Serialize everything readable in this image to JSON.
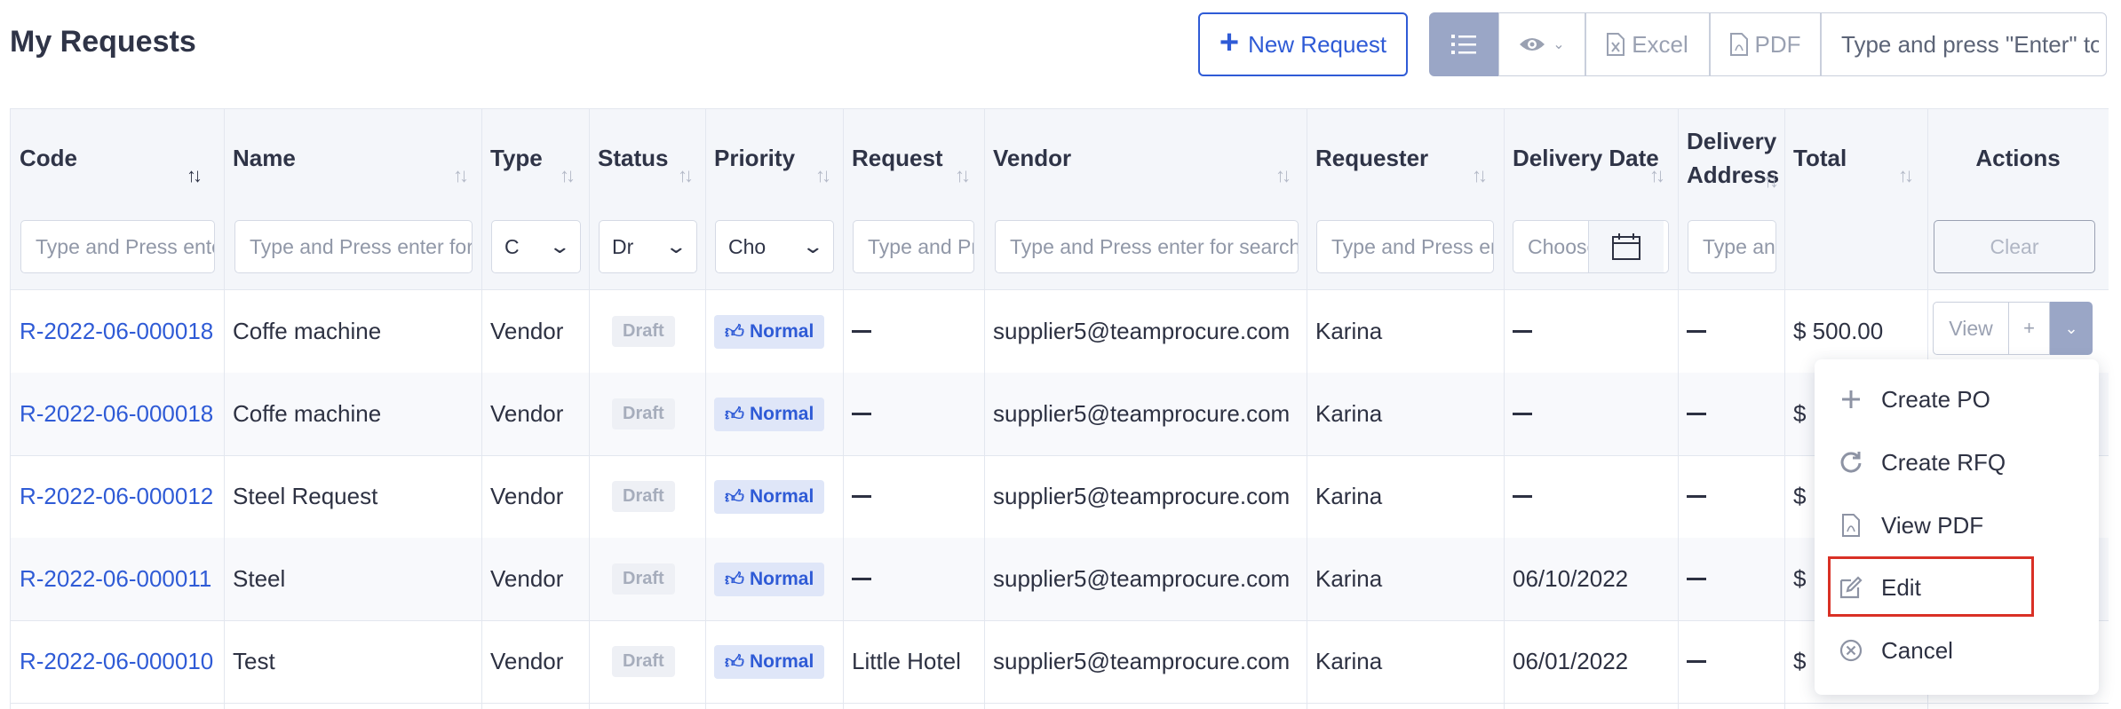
{
  "page": {
    "title": "My Requests"
  },
  "toolbar": {
    "new_request_label": "New Request",
    "excel_label": "Excel",
    "pdf_label": "PDF",
    "search_placeholder": "Type and press \"Enter\" to search"
  },
  "table": {
    "headers": {
      "code": "Code",
      "name": "Name",
      "type": "Type",
      "status": "Status",
      "priority": "Priority",
      "request": "Request",
      "vendor": "Vendor",
      "requester": "Requester",
      "delivery_date": "Delivery Date",
      "delivery_address_1": "Delivery",
      "delivery_address_2": "Address",
      "total": "Total",
      "actions": "Actions"
    },
    "filters": {
      "code": "Type and Press enter",
      "name": "Type and Press enter for search",
      "type": "C",
      "status": "Dr",
      "priority": "Cho",
      "request": "Type and Press",
      "vendor": "Type and Press enter for search",
      "requester": "Type and Press enter",
      "delivery_date": "Choose",
      "delivery_address": "Type and",
      "clear_label": "Clear"
    },
    "rows": [
      {
        "code": "R-2022-06-000018",
        "name": "Coffe machine",
        "type": "Vendor",
        "status": "Draft",
        "priority": "Normal",
        "request": "",
        "vendor": "supplier5@teamprocure.com",
        "requester": "Karina",
        "delivery_date": "",
        "delivery_address": "",
        "total": "$ 500.00"
      },
      {
        "code": "R-2022-06-000018",
        "name": "Coffe machine",
        "type": "Vendor",
        "status": "Draft",
        "priority": "Normal",
        "request": "",
        "vendor": "supplier5@teamprocure.com",
        "requester": "Karina",
        "delivery_date": "",
        "delivery_address": "",
        "total": "$"
      },
      {
        "code": "R-2022-06-000012",
        "name": "Steel Request",
        "type": "Vendor",
        "status": "Draft",
        "priority": "Normal",
        "request": "",
        "vendor": "supplier5@teamprocure.com",
        "requester": "Karina",
        "delivery_date": "",
        "delivery_address": "",
        "total": "$"
      },
      {
        "code": "R-2022-06-000011",
        "name": "Steel",
        "type": "Vendor",
        "status": "Draft",
        "priority": "Normal",
        "request": "",
        "vendor": "supplier5@teamprocure.com",
        "requester": "Karina",
        "delivery_date": "06/10/2022",
        "delivery_address": "",
        "total": "$"
      },
      {
        "code": "R-2022-06-000010",
        "name": "Test",
        "type": "Vendor",
        "status": "Draft",
        "priority": "Normal",
        "request": "Little Hotel",
        "vendor": "supplier5@teamprocure.com",
        "requester": "Karina",
        "delivery_date": "06/01/2022",
        "delivery_address": "",
        "total": "$"
      }
    ],
    "row_actions": {
      "view_label": "View",
      "add_label": "+"
    }
  },
  "action_menu": {
    "items": [
      {
        "label": "Create PO",
        "icon": "plus-icon"
      },
      {
        "label": "Create RFQ",
        "icon": "refresh-icon"
      },
      {
        "label": "View PDF",
        "icon": "pdf-file-icon"
      },
      {
        "label": "Edit",
        "icon": "edit-icon",
        "highlighted": true
      },
      {
        "label": "Cancel",
        "icon": "cancel-circle-icon"
      }
    ]
  },
  "colors": {
    "accent": "#2f5bd6",
    "highlight_border": "#d93025",
    "active_button": "#9aa6c6"
  }
}
